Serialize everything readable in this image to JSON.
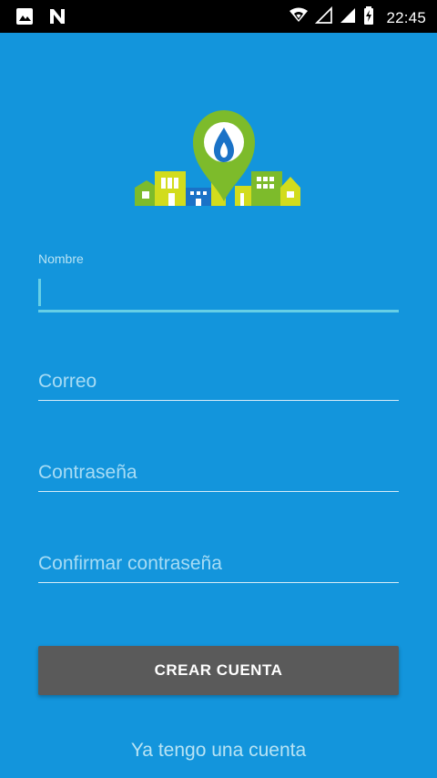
{
  "status_bar": {
    "time": "22:45",
    "left_icons": [
      "image-icon",
      "n-app-icon"
    ],
    "right_icons": [
      "wifi-icon",
      "signal-empty-icon",
      "signal-full-icon",
      "battery-charging-icon"
    ]
  },
  "form": {
    "name_label": "Nombre",
    "name_value": "",
    "email_placeholder": "Correo",
    "password_placeholder": "Contraseña",
    "confirm_password_placeholder": "Confirmar contraseña"
  },
  "actions": {
    "create_account_label": "CREAR CUENTA",
    "existing_account_label": "Ya tengo una cuenta"
  },
  "theme": {
    "background": "#1395dc",
    "button_background": "#5a5a5a",
    "accent": "#66cfe6",
    "logo_green": "#7dbb2b",
    "logo_lime": "#d2dc1d",
    "logo_blue": "#1a72c7"
  }
}
